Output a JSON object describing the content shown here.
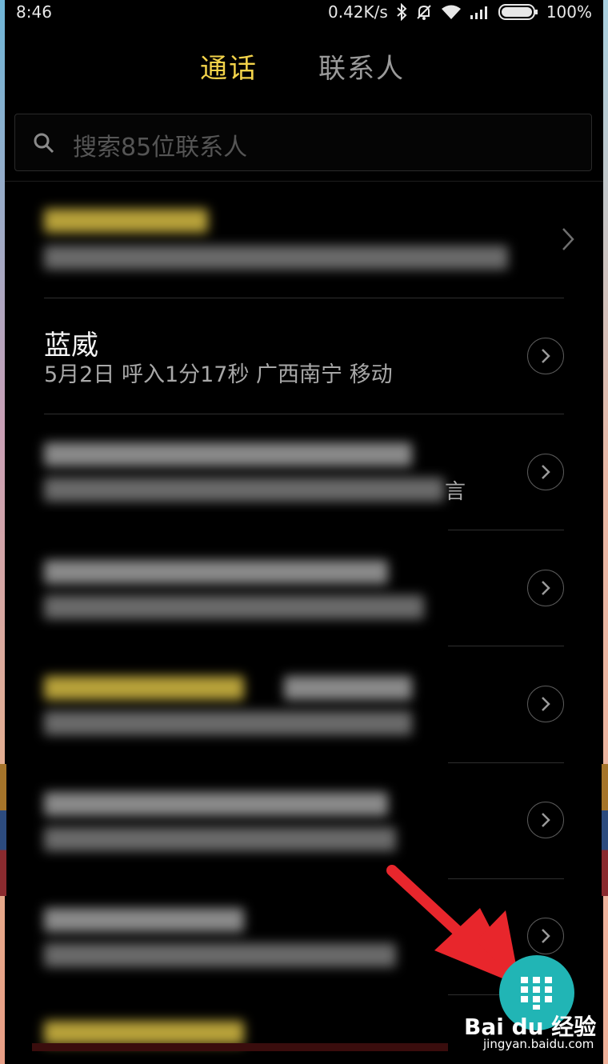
{
  "status_bar": {
    "time": "8:46",
    "network_speed": "0.42K/s",
    "battery": "100%",
    "icons": [
      "bluetooth-icon",
      "mute-icon",
      "wifi-icon",
      "signal-icon",
      "battery-icon"
    ]
  },
  "tabs": [
    {
      "label": "通话",
      "active": true
    },
    {
      "label": "联系人",
      "active": false
    }
  ],
  "search": {
    "placeholder": "搜索85位联系人"
  },
  "call_log": {
    "visible_entry": {
      "name": "蓝威",
      "detail": "5月2日 呼入1分17秒 广西南宁 移动"
    },
    "partial_text": "言"
  },
  "fab": {
    "icon": "dialpad-icon"
  },
  "watermark": {
    "brand": "Bai du 经验",
    "url": "jingyan.baidu.com"
  },
  "colors": {
    "accent": "#f3d34a",
    "fab": "#21b5b5",
    "arrow": "#e8262c",
    "background": "#000000"
  }
}
